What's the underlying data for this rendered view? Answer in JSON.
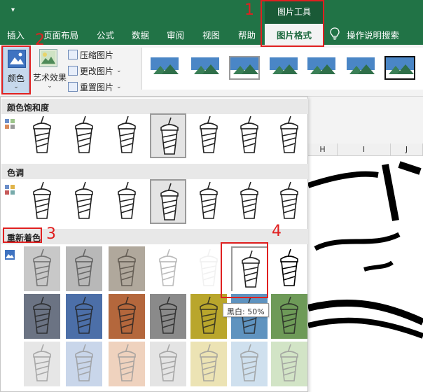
{
  "titlebar": {
    "quick_access": "▾",
    "context_group": "图片工具"
  },
  "tabs": [
    {
      "label": "插入"
    },
    {
      "label": "页面布局"
    },
    {
      "label": "公式"
    },
    {
      "label": "数据"
    },
    {
      "label": "审阅"
    },
    {
      "label": "视图"
    },
    {
      "label": "帮助"
    }
  ],
  "active_tab": "图片格式",
  "tell_me": "操作说明搜索",
  "ribbon": {
    "color_button": "颜色",
    "artistic_button": "艺术效果",
    "compress": "压缩图片",
    "change": "更改图片",
    "reset": "重置图片",
    "dropdown_chevron": "⌄"
  },
  "sheet_columns": [
    "H",
    "I",
    "J"
  ],
  "dropdown": {
    "saturation_header": "颜色饱和度",
    "tone_header": "色调",
    "recolor_header": "重新着色",
    "tooltip": "黑白: 50%",
    "recolor_row2_colors": [
      "#6b7383",
      "#4c6fa8",
      "#b4673c",
      "#8a8a8a",
      "#b9a62c",
      "#5f93bf",
      "#6e9a58"
    ],
    "recolor_row3_colors": [
      "#e6e6e6",
      "#c9d6ea",
      "#efd2be",
      "#e4e4e4",
      "#ece3b4",
      "#cfe0ee",
      "#d2e4c6"
    ]
  },
  "annotations": [
    "1",
    "2",
    "3",
    "4"
  ]
}
